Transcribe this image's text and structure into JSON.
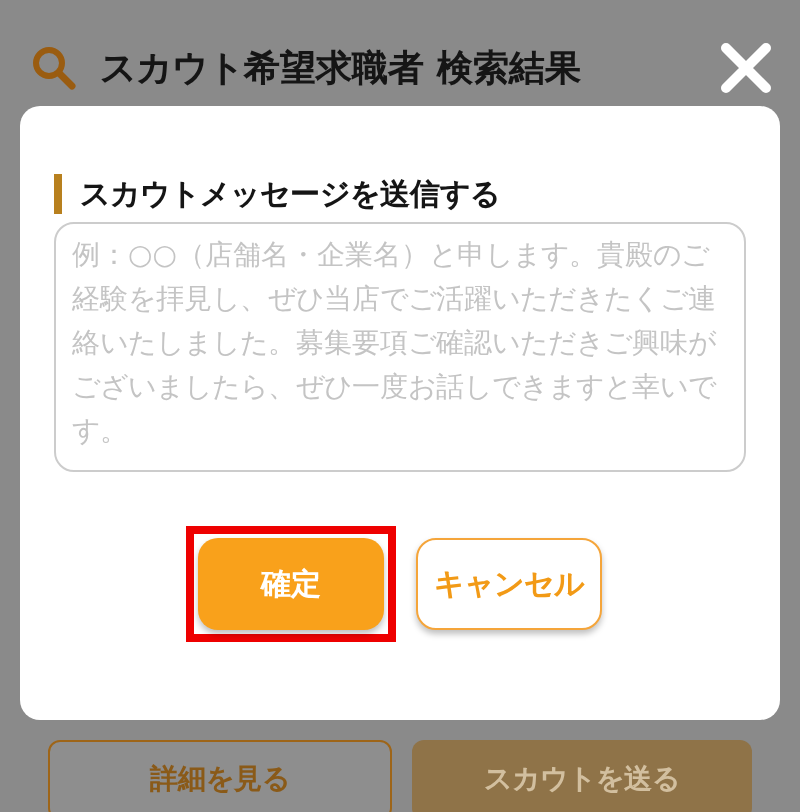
{
  "header": {
    "title": "スカウト希望求職者 検索結果"
  },
  "modal": {
    "heading": "スカウトメッセージを送信する",
    "message": {
      "placeholder": "例：○○（店舗名・企業名）と申します。貴殿のご経験を拝見し、ぜひ当店でご活躍いただきたくご連絡いたしました。募集要項ご確認いただきご興味がございましたら、ぜひ一度お話しできますと幸いです。"
    },
    "buttons": [
      {
        "label": "確定",
        "kind": "primary",
        "highlighted": true
      },
      {
        "label": "キャンセル",
        "kind": "outline",
        "highlighted": false
      }
    ]
  },
  "footer_buttons": [
    {
      "label": "詳細を見る",
      "kind": "outline"
    },
    {
      "label": "スカウトを送る",
      "kind": "primary"
    }
  ]
}
